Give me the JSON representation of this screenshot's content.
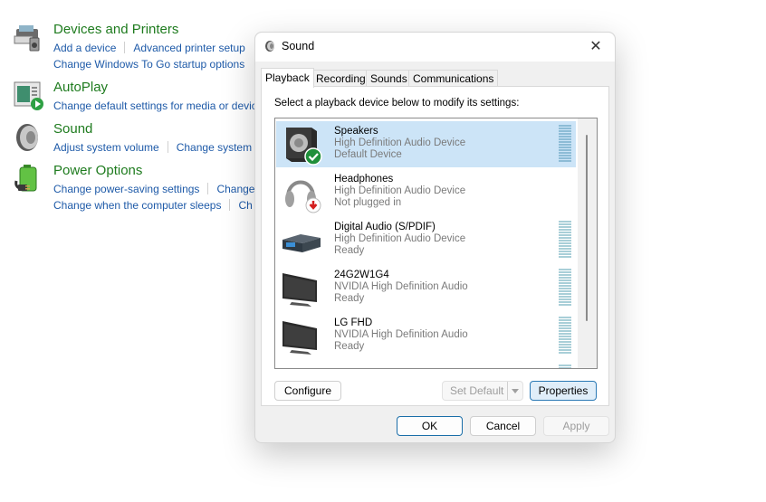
{
  "control_panel": {
    "categories": [
      {
        "icon": "devices-printers-icon",
        "title": "Devices and Printers",
        "links": [
          [
            "Add a device",
            "Advanced printer setup"
          ],
          [
            "Change Windows To Go startup options"
          ]
        ]
      },
      {
        "icon": "autoplay-icon",
        "title": "AutoPlay",
        "links": [
          [
            "Change default settings for media or devic"
          ]
        ]
      },
      {
        "icon": "sound-icon",
        "title": "Sound",
        "links": [
          [
            "Adjust system volume",
            "Change system"
          ]
        ]
      },
      {
        "icon": "power-options-icon",
        "title": "Power Options",
        "links": [
          [
            "Change power-saving settings",
            "Change"
          ],
          [
            "Change when the computer sleeps",
            "Ch"
          ]
        ]
      }
    ]
  },
  "dialog": {
    "title": "Sound",
    "close_label": "✕",
    "tabs": [
      "Playback",
      "Recording",
      "Sounds",
      "Communications"
    ],
    "active_tab": "Playback",
    "instruction": "Select a playback device below to modify its settings:",
    "devices": [
      {
        "name": "Speakers",
        "driver": "High Definition Audio Device",
        "status": "Default Device",
        "icon": "speakers-icon",
        "badge": "default-check-icon",
        "selected": true,
        "meter": true
      },
      {
        "name": "Headphones",
        "driver": "High Definition Audio Device",
        "status": "Not plugged in",
        "icon": "headphones-icon",
        "badge": "unplugged-arrow-icon",
        "selected": false,
        "meter": false
      },
      {
        "name": "Digital Audio (S/PDIF)",
        "driver": "High Definition Audio Device",
        "status": "Ready",
        "icon": "digital-audio-icon",
        "badge": null,
        "selected": false,
        "meter": true
      },
      {
        "name": "24G2W1G4",
        "driver": "NVIDIA High Definition Audio",
        "status": "Ready",
        "icon": "monitor-icon",
        "badge": null,
        "selected": false,
        "meter": true
      },
      {
        "name": "LG FHD",
        "driver": "NVIDIA High Definition Audio",
        "status": "Ready",
        "icon": "monitor-icon",
        "badge": null,
        "selected": false,
        "meter": true
      }
    ],
    "buttons": {
      "configure": "Configure",
      "set_default": "Set Default",
      "properties": "Properties",
      "ok": "OK",
      "cancel": "Cancel",
      "apply": "Apply"
    }
  },
  "colors": {
    "category_title": "#1e7b1e",
    "link": "#1e5aa8",
    "selection": "#cce4f7",
    "primary_border": "#1a6ea8"
  }
}
